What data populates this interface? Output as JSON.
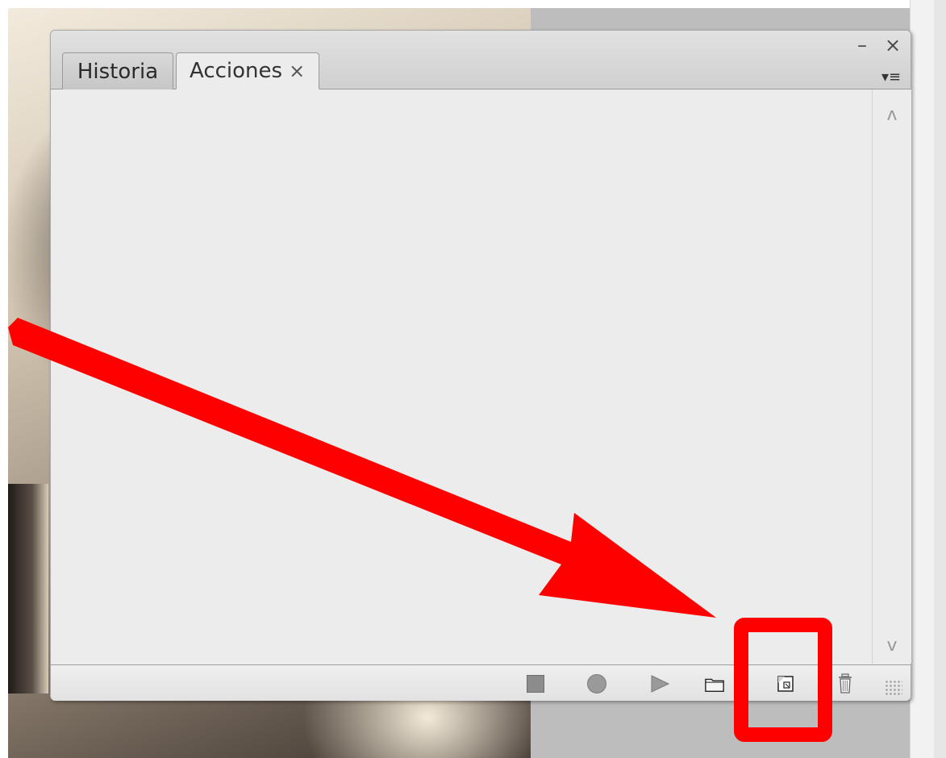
{
  "panel": {
    "tabs": [
      {
        "label": "Historia",
        "active": false
      },
      {
        "label": "Acciones",
        "active": true,
        "close_glyph": "×"
      }
    ],
    "window_controls": {
      "minimize": "–",
      "close": "×"
    },
    "menu_glyph": "▾≡",
    "scroll": {
      "up": "ʌ",
      "down": "v"
    },
    "footer_buttons": [
      {
        "name": "stop-playing-recording",
        "icon": "stop-icon"
      },
      {
        "name": "begin-recording",
        "icon": "record-icon"
      },
      {
        "name": "play-selection",
        "icon": "play-icon"
      },
      {
        "name": "create-new-set",
        "icon": "folder-icon"
      },
      {
        "name": "create-new-action",
        "icon": "new-action-icon",
        "highlighted": true
      },
      {
        "name": "delete",
        "icon": "trash-icon"
      }
    ]
  },
  "annotation": {
    "color": "#ff0000",
    "arrow_target": "create-new-action",
    "highlight_box_target": "create-new-action"
  },
  "colors": {
    "panel_bg": "#ececec",
    "header_bg": "#d4d4d4",
    "canvas_gray": "#bdbdbd",
    "annotation_red": "#ff0000"
  }
}
